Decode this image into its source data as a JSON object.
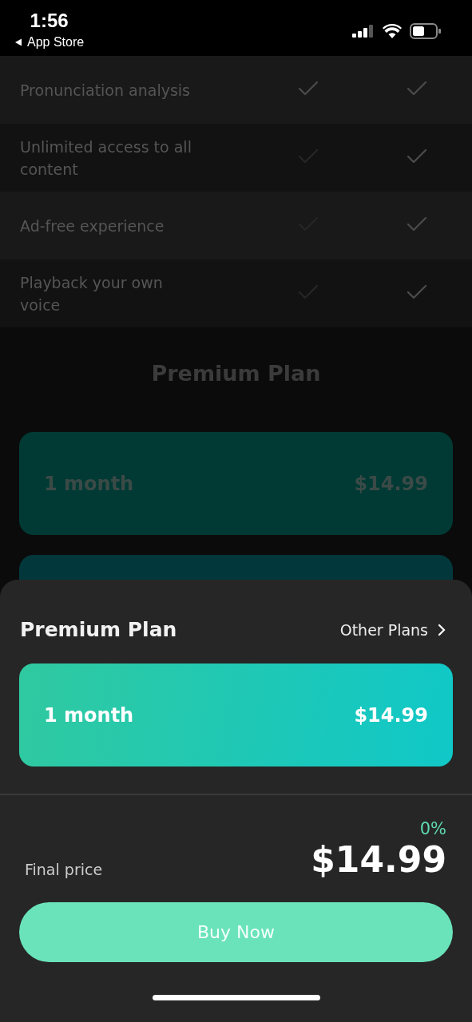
{
  "status_bar": {
    "time": "1:56",
    "back_label": "App Store"
  },
  "features": [
    {
      "label": "Pronunciation analysis",
      "free": true,
      "premium": true
    },
    {
      "label": "Unlimited access to all content",
      "free": false,
      "premium": true
    },
    {
      "label": "Ad-free experience",
      "free": false,
      "premium": true
    },
    {
      "label": "Playback your own voice",
      "free": false,
      "premium": true
    }
  ],
  "background_plan": {
    "title": "Premium Plan",
    "period": "1 month",
    "price": "$14.99"
  },
  "sheet": {
    "title": "Premium Plan",
    "other_plans": "Other Plans",
    "plan": {
      "period": "1 month",
      "price": "$14.99"
    },
    "discount": "0%",
    "final_label": "Final price",
    "final_price": "$14.99",
    "buy": "Buy Now"
  }
}
